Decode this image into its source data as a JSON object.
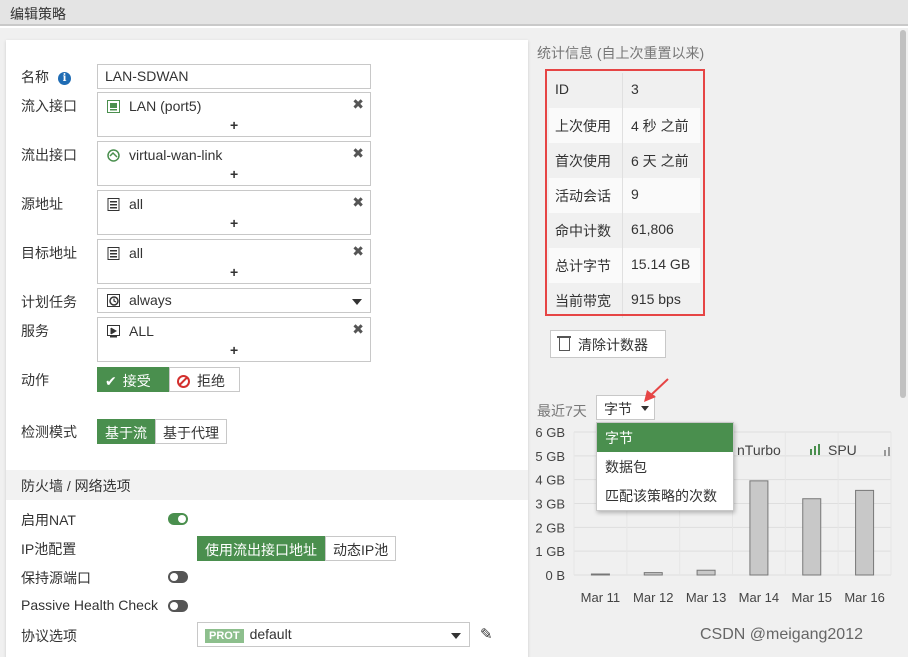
{
  "window": {
    "title": "编辑策略"
  },
  "form": {
    "name_label": "名称",
    "name_value": "LAN-SDWAN",
    "incoming_label": "流入接口",
    "incoming_value": "LAN (port5)",
    "outgoing_label": "流出接口",
    "outgoing_value": "virtual-wan-link",
    "source_label": "源地址",
    "source_value": "all",
    "dest_label": "目标地址",
    "dest_value": "all",
    "schedule_label": "计划任务",
    "schedule_value": "always",
    "service_label": "服务",
    "service_value": "ALL",
    "action_label": "动作",
    "action_accept": "接受",
    "action_deny": "拒绝",
    "inspect_label": "检测模式",
    "inspect_flow": "基于流",
    "inspect_proxy": "基于代理",
    "remove_glyph": "✖",
    "add_glyph": "+"
  },
  "firewall_section": {
    "title": "防火墙 / 网络选项",
    "nat_label": "启用NAT",
    "nat_enabled": true,
    "ippool_label": "IP池配置",
    "ippool_outgoing": "使用流出接口地址",
    "ippool_dynamic": "动态IP池",
    "preserve_port_label": "保持源端口",
    "preserve_port_enabled": false,
    "phc_label": "Passive Health Check",
    "phc_enabled": false,
    "protocol_label": "协议选项",
    "protocol_tag": "PROT",
    "protocol_value": "default"
  },
  "stats": {
    "title": "统计信息 (自上次重置以来)",
    "rows": [
      {
        "key": "ID",
        "value": "3"
      },
      {
        "key": "上次使用",
        "value": "4 秒 之前"
      },
      {
        "key": "首次使用",
        "value": "6 天 之前"
      },
      {
        "key": "活动会话",
        "value": "9"
      },
      {
        "key": "命中计数",
        "value": "61,806"
      },
      {
        "key": "总计字节",
        "value": "15.14 GB"
      },
      {
        "key": "当前带宽",
        "value": "915 bps"
      }
    ],
    "clear_button": "清除计数器"
  },
  "chart_panel": {
    "range_label": "最近7天",
    "metric_selected": "字节",
    "dropdown_options": [
      "字节",
      "数据包",
      "匹配该策略的次数"
    ],
    "legend": [
      "nTurbo",
      "SPU"
    ]
  },
  "chart_data": {
    "type": "bar",
    "categories": [
      "Mar 11",
      "Mar 12",
      "Mar 13",
      "Mar 14",
      "Mar 15",
      "Mar 16"
    ],
    "values": [
      0.02,
      0.1,
      0.2,
      3.95,
      3.2,
      3.55
    ],
    "yticks": [
      "0 B",
      "1 GB",
      "2 GB",
      "3 GB",
      "4 GB",
      "5 GB",
      "6 GB"
    ],
    "ylim": [
      0,
      6
    ],
    "grid": true,
    "bar_color": "#c8c8c8"
  },
  "colors": {
    "accent": "#4a8f4e",
    "highlight": "#e64545",
    "info": "#1f6cb4"
  },
  "watermark": "CSDN @meigang2012"
}
